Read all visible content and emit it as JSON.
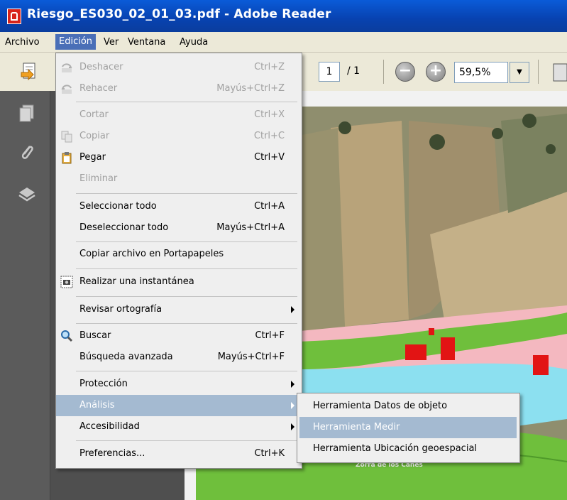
{
  "window": {
    "title": "Riesgo_ES030_02_01_03.pdf - Adobe Reader"
  },
  "menubar": [
    {
      "label": "Archivo"
    },
    {
      "label": "Edición"
    },
    {
      "label": "Ver"
    },
    {
      "label": "Ventana"
    },
    {
      "label": "Ayuda"
    }
  ],
  "toolbar": {
    "page_current": "1",
    "page_total": "/ 1",
    "zoom": "59,5%",
    "zoom_out": "−",
    "zoom_in": "+"
  },
  "edit_menu": [
    {
      "label": "Deshacer",
      "shortcut": "Ctrl+Z"
    },
    {
      "label": "Rehacer",
      "shortcut": "Mayús+Ctrl+Z"
    },
    {
      "label": "Cortar",
      "shortcut": "Ctrl+X"
    },
    {
      "label": "Copiar",
      "shortcut": "Ctrl+C"
    },
    {
      "label": "Pegar",
      "shortcut": "Ctrl+V"
    },
    {
      "label": "Eliminar",
      "shortcut": ""
    },
    {
      "label": "Seleccionar todo",
      "shortcut": "Ctrl+A"
    },
    {
      "label": "Deseleccionar todo",
      "shortcut": "Mayús+Ctrl+A"
    },
    {
      "label": "Copiar archivo en Portapapeles",
      "shortcut": ""
    },
    {
      "label": "Realizar una instantánea",
      "shortcut": ""
    },
    {
      "label": "Revisar ortografía",
      "shortcut": ""
    },
    {
      "label": "Buscar",
      "shortcut": "Ctrl+F"
    },
    {
      "label": "Búsqueda avanzada",
      "shortcut": "Mayús+Ctrl+F"
    },
    {
      "label": "Protección",
      "shortcut": ""
    },
    {
      "label": "Análisis",
      "shortcut": ""
    },
    {
      "label": "Accesibilidad",
      "shortcut": ""
    },
    {
      "label": "Preferencias...",
      "shortcut": "Ctrl+K"
    }
  ],
  "analysis_submenu": [
    {
      "label": "Herramienta Datos de objeto"
    },
    {
      "label": "Herramienta Medir"
    },
    {
      "label": "Herramienta Ubicación geoespacial"
    }
  ],
  "map": {
    "label": "Zorra de los Canes"
  },
  "colors": {
    "menu_highlight": "#a4bad1",
    "titlebar": "#0a5bd8",
    "flood_zone": "#f4b8c0",
    "river": "#8ce0f0",
    "vegetation": "#6fbf3c"
  }
}
